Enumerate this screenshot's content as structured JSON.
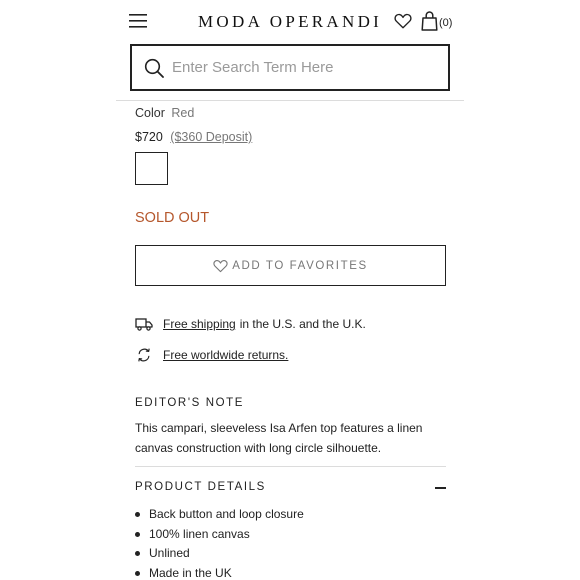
{
  "header": {
    "logo": "MODA OPERANDI",
    "bag_count": "(0)"
  },
  "search": {
    "placeholder": "Enter Search Term Here",
    "value": ""
  },
  "product": {
    "color_label": "Color",
    "color_value": "Red",
    "price": "$720",
    "deposit": "($360 Deposit)",
    "status": "SOLD OUT",
    "favorite_button_label": "ADD TO FAVORITES"
  },
  "shipping": {
    "free_shipping_link": "Free shipping",
    "free_shipping_text": "in the U.S. and the U.K.",
    "returns_link": "Free worldwide returns."
  },
  "editors_note": {
    "heading": "EDITOR'S NOTE",
    "body": "This campari, sleeveless Isa Arfen top features a linen canvas construction with long circle silhouette."
  },
  "product_details": {
    "heading": "PRODUCT DETAILS",
    "items": [
      "Back button and loop closure",
      "100% linen canvas",
      "Unlined",
      "Made in the UK"
    ]
  },
  "icons": {
    "menu": "hamburger-menu-icon",
    "favorites": "heart-icon",
    "bag": "shopping-bag-icon",
    "search": "search-icon",
    "shipping": "truck-icon",
    "returns": "return-arrows-icon",
    "collapse": "minus-icon"
  },
  "colors": {
    "sold_out": "#b5572c",
    "text": "#222222",
    "muted": "#777777"
  }
}
